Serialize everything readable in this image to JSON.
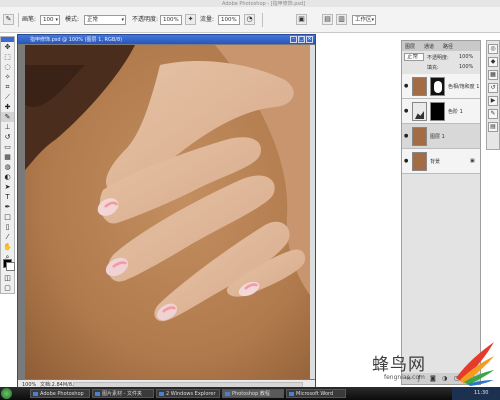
{
  "app": {
    "title_bar": "Adobe Photoshop - [指甲修饰.psd]"
  },
  "options_bar": {
    "brush_label": "画笔:",
    "brush_size": "100",
    "mode_label": "模式:",
    "mode_value": "正常",
    "opacity_label": "不透明度:",
    "opacity_value": "100%",
    "flow_label": "流量:",
    "flow_value": "100%",
    "workspace_label": "工作区"
  },
  "document": {
    "title": "指甲修饰.psd @ 100% (图层 1, RGB/8)",
    "status_zoom": "100%",
    "status_info": "文档:2.84M/8.52M"
  },
  "layers_panel": {
    "tabs": [
      "图层",
      "通道",
      "路径"
    ],
    "blend_mode": "正常",
    "opacity_label": "不透明度:",
    "opacity_value": "100%",
    "fill_label": "填充:",
    "fill_value": "100%",
    "layers": [
      {
        "name": "色相/饱和度 1",
        "selected": false
      },
      {
        "name": "色阶 1",
        "selected": false
      },
      {
        "name": "图层 1",
        "selected": true
      },
      {
        "name": "背景",
        "selected": false
      }
    ]
  },
  "watermark": {
    "text": "蜂鸟网",
    "url": "fengniao.com"
  },
  "taskbar": {
    "items": [
      {
        "label": "Adobe Photoshop",
        "active": false
      },
      {
        "label": "图片素材 - 文件夹",
        "active": false
      },
      {
        "label": "2 Windows Explorer",
        "active": false
      },
      {
        "label": "Photoshop 教程",
        "active": true
      },
      {
        "label": "Microsoft Word",
        "active": false
      }
    ],
    "clock": "11:30"
  },
  "colors": {
    "skin": "#b27c50",
    "titlebar_blue": "#2b55b8",
    "canvas_gray": "#7a7a7a"
  }
}
